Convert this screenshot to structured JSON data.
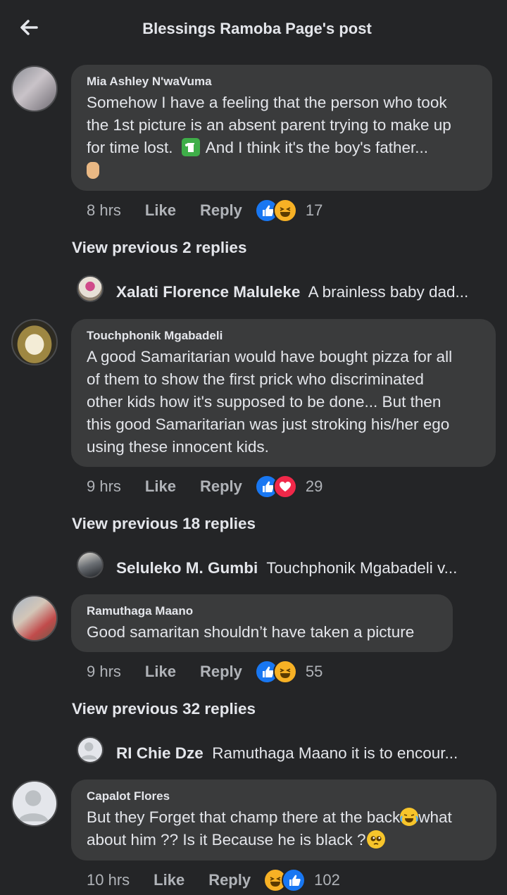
{
  "header": {
    "title": "Blessings Ramoba Page's post"
  },
  "comments": [
    {
      "author": "Mia Ashley N'waVuma",
      "text_lines": [
        "Somehow I have a feeling that the person who took",
        "the 1st picture is an absent parent trying to make up",
        "for time lost.",
        "And I think it's the boy's father..."
      ],
      "time": "8 hrs",
      "like": "Like",
      "reply": "Reply",
      "count": "17",
      "view_previous": "View previous 2 replies",
      "reply_preview": {
        "name": "Xalati Florence Maluleke",
        "text": "A brainless baby dad..."
      }
    },
    {
      "author": "Touchphonik Mgabadeli",
      "text_lines": [
        "A good Samaritarian would have bought pizza for all",
        "of them to show the first prick who discriminated",
        "other kids how it's supposed to be done... But then",
        "this good Samaritarian was just stroking his/her ego",
        "using these innocent kids."
      ],
      "time": "9 hrs",
      "like": "Like",
      "reply": "Reply",
      "count": "29",
      "view_previous": "View previous 18 replies",
      "reply_preview": {
        "name": "Seluleko M. Gumbi",
        "text": "Touchphonik Mgabadeli v..."
      }
    },
    {
      "author": "Ramuthaga Maano",
      "text_lines": [
        "Good samaritan shouldn’t have taken a picture"
      ],
      "time": "9 hrs",
      "like": "Like",
      "reply": "Reply",
      "count": "55",
      "view_previous": "View previous 32 replies",
      "reply_preview": {
        "name": "RI Chie Dze",
        "text": "Ramuthaga Maano it is to encour..."
      }
    },
    {
      "author": "Capalot Flores",
      "text_lines": [
        "But they Forget that champ there at the back",
        "what",
        "about him ?? Is it Because he is black ?"
      ],
      "time": "10 hrs",
      "like": "Like",
      "reply": "Reply",
      "count": "102"
    }
  ],
  "colors": {
    "background": "#242527",
    "bubble": "#3a3b3c",
    "like_blue": "#1877f2",
    "love_red": "#f02849",
    "haha_yellow": "#f7b125"
  },
  "icons": [
    "back-arrow-icon",
    "like-reaction-icon",
    "haha-reaction-icon",
    "love-reaction-icon",
    "trash-emoji-icon",
    "crossed-fingers-emoji-icon",
    "crying-laughing-emoji-icon",
    "pleading-face-emoji-icon"
  ]
}
